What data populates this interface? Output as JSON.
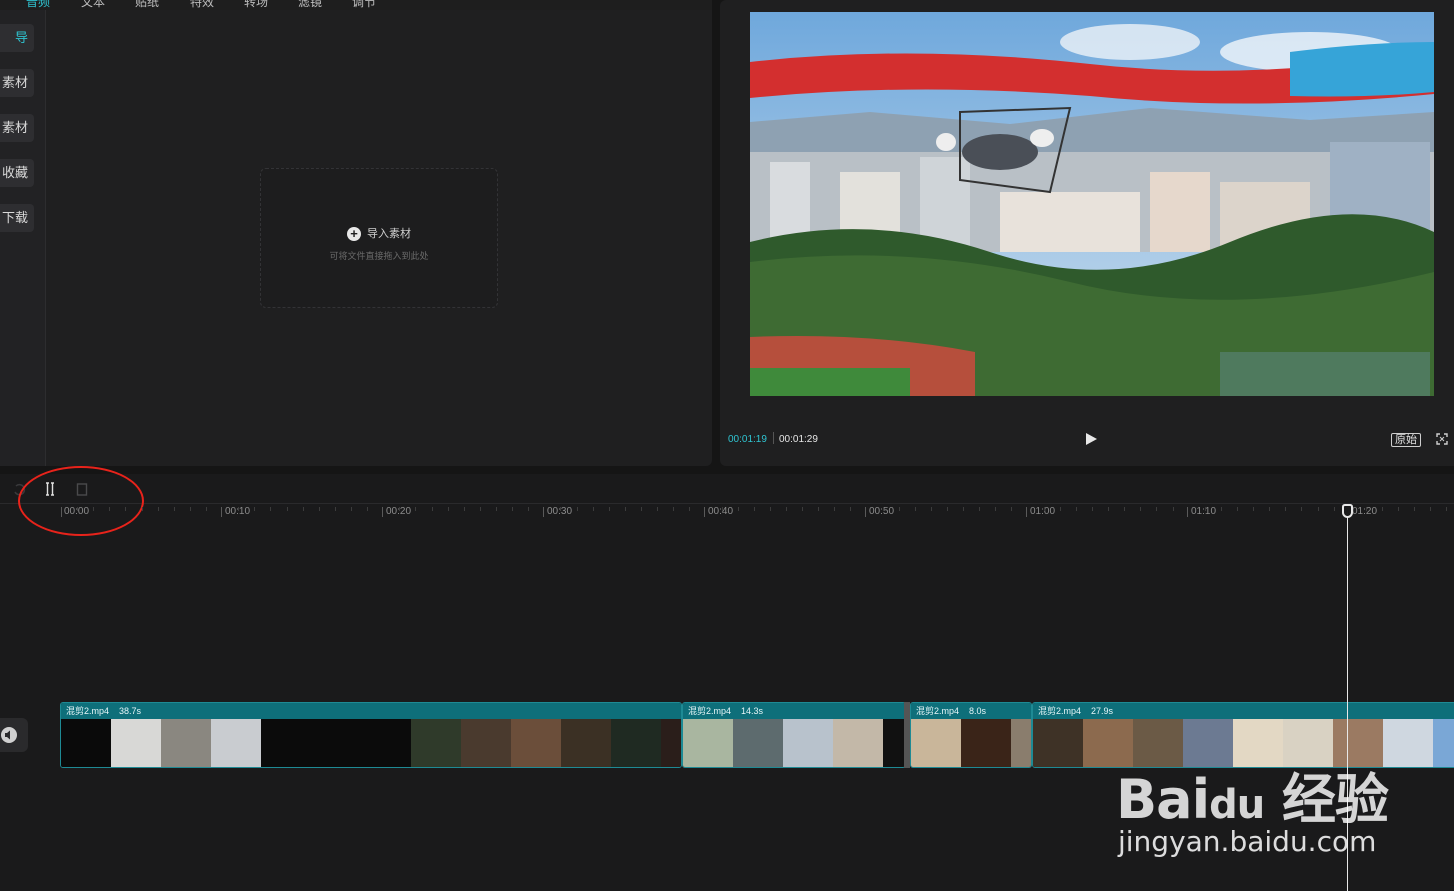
{
  "top_tabs": [
    "音频",
    "文本",
    "贴纸",
    "特效",
    "转场",
    "滤镜",
    "调节"
  ],
  "sidebar": {
    "items": [
      {
        "label": "导",
        "active": true
      },
      {
        "label": "素材"
      },
      {
        "label": "素材"
      },
      {
        "label": "收藏"
      },
      {
        "label": "下载"
      }
    ]
  },
  "import": {
    "label": "导入素材",
    "hint": "可将文件直接拖入到此处"
  },
  "preview": {
    "current_time": "00:01:19",
    "total_time": "00:01:29",
    "orig_label": "原始"
  },
  "timeline": {
    "ruler_labels": [
      "00:00",
      "00:10",
      "00:20",
      "00:30",
      "00:40",
      "00:50",
      "01:00",
      "01:10",
      "01:20"
    ],
    "clips": [
      {
        "name": "混剪2.mp4",
        "duration": "38.7s"
      },
      {
        "name": "混剪2.mp4",
        "duration": "14.3s"
      },
      {
        "name": "混剪2.mp4",
        "duration": "8.0s"
      },
      {
        "name": "混剪2.mp4",
        "duration": "27.9s"
      }
    ]
  },
  "watermark": {
    "logo": "Bai du 经验",
    "url": "jingyan.baidu.com"
  },
  "colors": {
    "accent": "#2fc4d1",
    "clip_header": "#0e6f7a",
    "highlight": "#e8231b"
  }
}
